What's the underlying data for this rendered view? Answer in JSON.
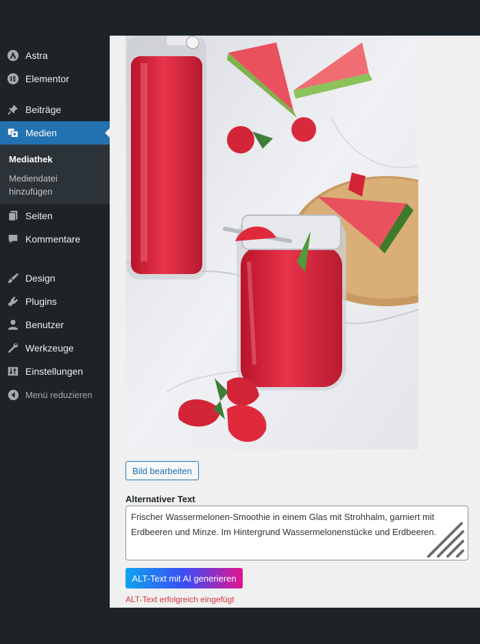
{
  "sidebar": {
    "items": [
      {
        "label": "Astra",
        "icon": "astra-icon"
      },
      {
        "label": "Elementor",
        "icon": "elementor-icon"
      },
      {
        "label": "Beiträge",
        "icon": "pin-icon"
      },
      {
        "label": "Medien",
        "icon": "media-icon",
        "active": true
      },
      {
        "label": "Seiten",
        "icon": "pages-icon"
      },
      {
        "label": "Kommentare",
        "icon": "comment-icon"
      },
      {
        "label": "Design",
        "icon": "brush-icon"
      },
      {
        "label": "Plugins",
        "icon": "plugin-icon"
      },
      {
        "label": "Benutzer",
        "icon": "user-icon"
      },
      {
        "label": "Werkzeuge",
        "icon": "wrench-icon"
      },
      {
        "label": "Einstellungen",
        "icon": "settings-icon"
      }
    ],
    "submenu": [
      {
        "label": "Mediathek"
      },
      {
        "label": "Mediendatei hinzufügen"
      }
    ],
    "collapse_label": "Menü reduzieren"
  },
  "main": {
    "edit_button": "Bild bearbeiten",
    "alt_label": "Alternativer Text",
    "alt_text": "Frischer Wassermelonen-Smoothie in einem Glas mit Strohhalm, garniert mit Erdbeeren und Minze. Im Hintergrund Wassermelonenstücke und Erdbeeren.",
    "ai_button": "ALT-Text mit AI generieren",
    "success_message": "ALT-Text erfolgreich eingefügt"
  },
  "colors": {
    "admin_bg": "#1d2327",
    "accent": "#2271b1",
    "content_bg": "#f0f0f1",
    "error": "#d63638"
  }
}
